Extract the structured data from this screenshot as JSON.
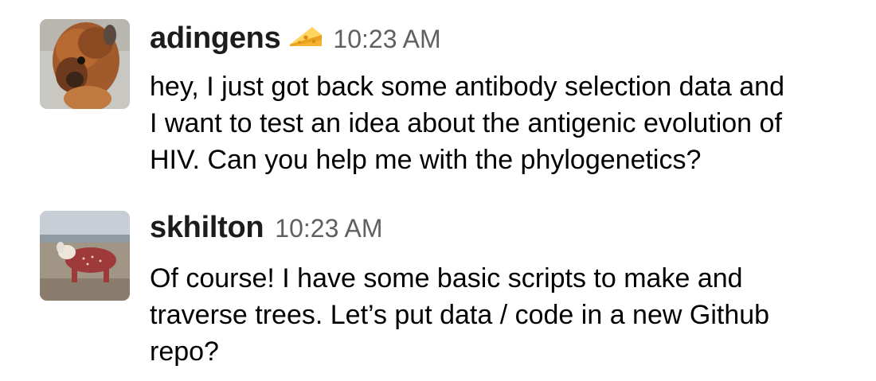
{
  "messages": [
    {
      "username": "adingens",
      "status_icon": "cheese-icon",
      "timestamp": "10:23 AM",
      "text": "hey, I just got back some antibody selection data and\nI want to test an idea about the antigenic evolution of\nHIV. Can you help me with the phylogenetics?",
      "avatar": "alpaca-avatar"
    },
    {
      "username": "skhilton",
      "timestamp": "10:23 AM",
      "text": "Of course! I have some basic scripts to make and\ntraverse trees. Let’s put data / code in a new Github\nrepo?",
      "avatar": "pony-in-sweater-avatar"
    }
  ],
  "colors": {
    "username": "#1d1c1d",
    "timestamp": "#616061",
    "text": "#000000",
    "cheese": "#f4b430"
  }
}
